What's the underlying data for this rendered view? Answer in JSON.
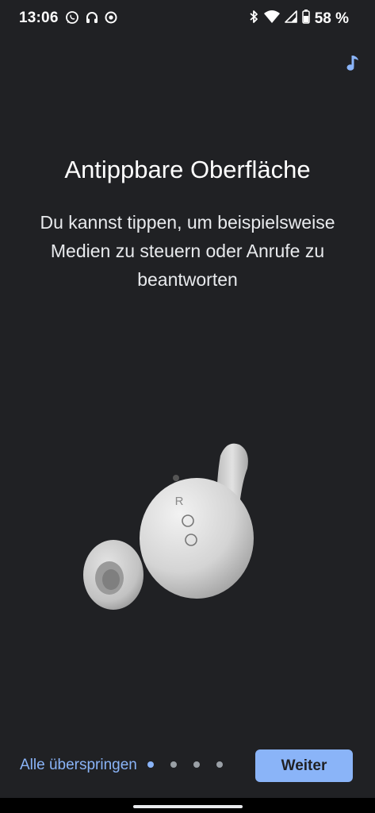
{
  "status_bar": {
    "time": "13:06",
    "left_icons": [
      "whatsapp-icon",
      "headphones-icon",
      "media-icon"
    ],
    "right_icons": [
      "bluetooth-icon",
      "wifi-icon",
      "cell-signal-icon",
      "battery-icon"
    ],
    "battery": "58 %"
  },
  "header": {
    "music_icon": "music-note-icon"
  },
  "main": {
    "title": "Antippbare Oberfläche",
    "description": "Du kannst tippen, um beispielsweise Medien zu steuern oder Anrufe zu beantworten",
    "illustration": "earbud-illustration",
    "earbud_label": "R"
  },
  "footer": {
    "skip_label": "Alle überspringen",
    "next_label": "Weiter",
    "page_count": 4,
    "active_page": 1
  },
  "colors": {
    "background": "#202124",
    "accent": "#8ab4f8",
    "text": "#e8eaed",
    "dot_inactive": "#9aa0a6"
  }
}
